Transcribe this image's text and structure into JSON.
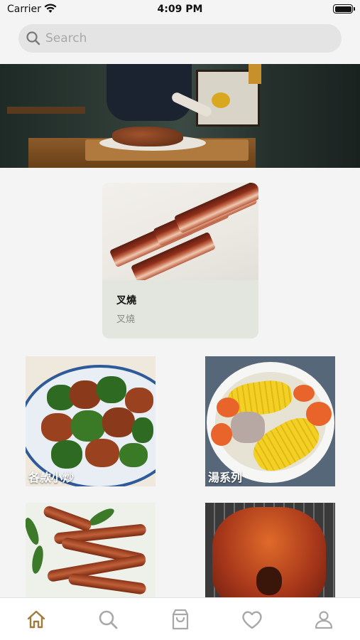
{
  "status_bar": {
    "carrier": "Carrier",
    "time": "4:09 PM"
  },
  "search": {
    "placeholder": "Search",
    "icon": "search-icon"
  },
  "featured": {
    "title": "叉燒",
    "subtitle": "叉燒"
  },
  "categories": [
    {
      "label": "各款小炒"
    },
    {
      "label": "湯系列"
    },
    {
      "label": ""
    },
    {
      "label": ""
    }
  ],
  "tab_bar": {
    "items": [
      {
        "icon": "home-icon",
        "active": true
      },
      {
        "icon": "search-icon",
        "active": false
      },
      {
        "icon": "shopping-bag-icon",
        "active": false
      },
      {
        "icon": "heart-icon",
        "active": false
      },
      {
        "icon": "profile-icon",
        "active": false
      }
    ],
    "active_color": "#a07a3a",
    "inactive_color": "#a8a8a8"
  }
}
